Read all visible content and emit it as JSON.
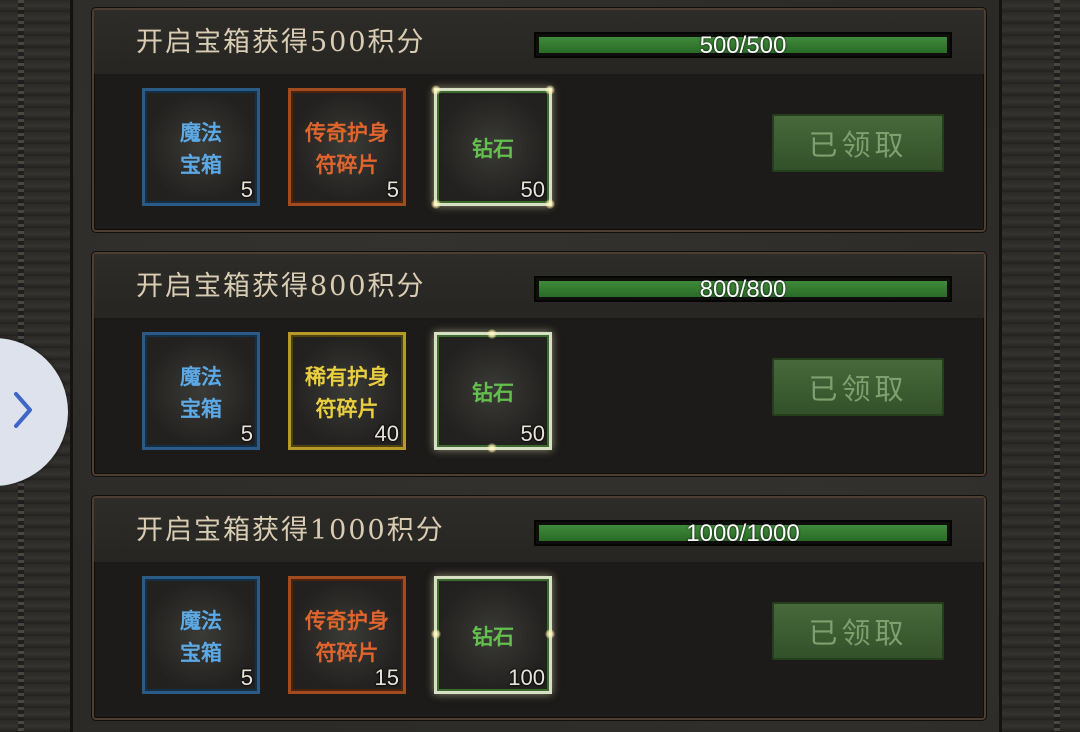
{
  "rewards": [
    {
      "title": "开启宝箱获得500积分",
      "progress_text": "500/500",
      "progress_fraction": 1.0,
      "items": [
        {
          "name_line1": "魔法",
          "name_line2": "宝箱",
          "count": "5",
          "quality": "blue"
        },
        {
          "name_line1": "传奇护身",
          "name_line2": "符碎片",
          "count": "5",
          "quality": "orange"
        },
        {
          "name_line1": "钻石",
          "name_line2": "",
          "count": "50",
          "quality": "green"
        }
      ],
      "button_label": "已领取"
    },
    {
      "title": "开启宝箱获得800积分",
      "progress_text": "800/800",
      "progress_fraction": 1.0,
      "items": [
        {
          "name_line1": "魔法",
          "name_line2": "宝箱",
          "count": "5",
          "quality": "blue"
        },
        {
          "name_line1": "稀有护身",
          "name_line2": "符碎片",
          "count": "40",
          "quality": "gold"
        },
        {
          "name_line1": "钻石",
          "name_line2": "",
          "count": "50",
          "quality": "green"
        }
      ],
      "button_label": "已领取"
    },
    {
      "title": "开启宝箱获得1000积分",
      "progress_text": "1000/1000",
      "progress_fraction": 1.0,
      "items": [
        {
          "name_line1": "魔法",
          "name_line2": "宝箱",
          "count": "5",
          "quality": "blue"
        },
        {
          "name_line1": "传奇护身",
          "name_line2": "符碎片",
          "count": "15",
          "quality": "orange"
        },
        {
          "name_line1": "钻石",
          "name_line2": "",
          "count": "100",
          "quality": "green"
        }
      ],
      "button_label": "已领取"
    }
  ],
  "side_tab": {
    "icon": "chevron-right-icon"
  },
  "colors": {
    "progress_fill": "#3f8a3a",
    "quality_blue": "#5ba9e6",
    "quality_orange": "#e0642c",
    "quality_gold": "#e9cf3d",
    "quality_green": "#64c04d",
    "claimed_button": "#46693a",
    "title_text": "#d8cdb3"
  }
}
